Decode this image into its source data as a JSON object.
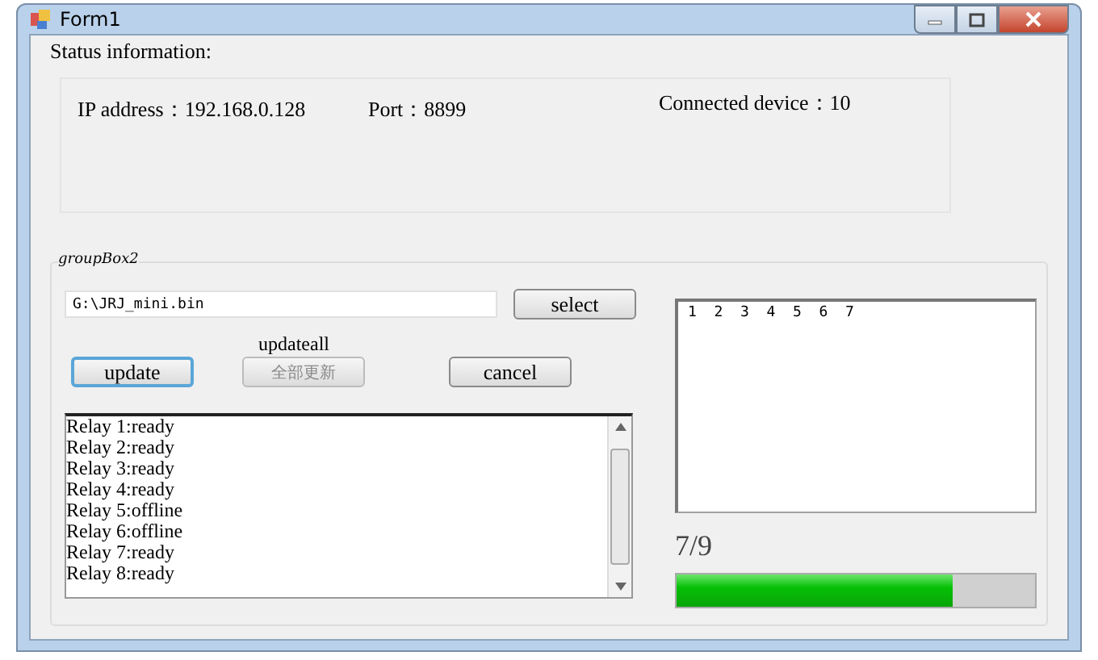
{
  "window": {
    "title": "Form1"
  },
  "status": {
    "heading": "Status information:",
    "fields": [
      {
        "label": "IP address：",
        "value": "192.168.0.128"
      },
      {
        "label": "Port：",
        "value": "8899"
      },
      {
        "label": "Connected device：",
        "value": "10"
      }
    ]
  },
  "group": {
    "title": "groupBox2",
    "file_path": "G:\\JRJ_mini.bin",
    "select_button": "select",
    "updateall_label": "updateall",
    "buttons": [
      {
        "label": "update",
        "disabled": false,
        "focused": true
      },
      {
        "label": "全部更新",
        "disabled": true,
        "focused": false
      },
      {
        "label": "cancel",
        "disabled": false,
        "focused": false
      }
    ],
    "relays": [
      "Relay 1:ready",
      "Relay 2:ready",
      "Relay 3:ready",
      "Relay 4:ready",
      "Relay 5:offline",
      "Relay 6:offline",
      "Relay 7:ready",
      "Relay 8:ready"
    ],
    "output": "1  2  3  4  5  6  7",
    "progress_text": "7/9",
    "progress": {
      "level": 0.77
    }
  }
}
